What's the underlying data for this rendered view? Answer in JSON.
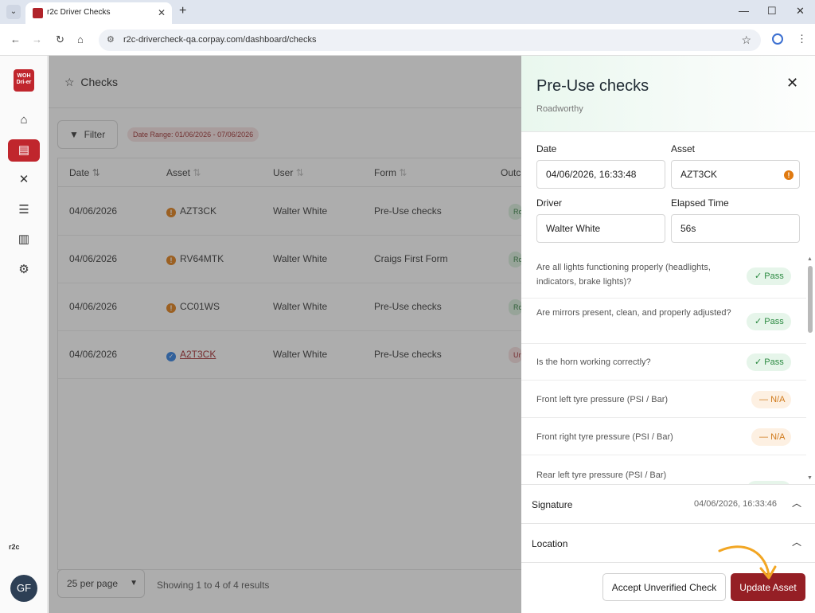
{
  "browser": {
    "tab_title": "r2c Driver Checks",
    "url": "r2c-drivercheck-qa.corpay.com/dashboard/checks"
  },
  "sidebar": {
    "logo_text": "Dri-er",
    "items": [
      {
        "icon": "home-icon"
      },
      {
        "icon": "clipboard-icon",
        "active": true
      },
      {
        "icon": "tools-icon"
      },
      {
        "icon": "list-icon"
      },
      {
        "icon": "chart-icon"
      },
      {
        "icon": "settings-icon"
      }
    ],
    "brand": "r2c",
    "avatar_initials": "GF"
  },
  "page": {
    "title": "Checks",
    "filter_label": "Filter",
    "date_range": "Date Range: 01/06/2026 - 07/06/2026"
  },
  "table": {
    "headers": [
      "Date",
      "Asset",
      "User",
      "Form",
      "Outc"
    ],
    "rows": [
      {
        "date": "04/06/2026",
        "asset": "AZT3CK",
        "verified": false,
        "user": "Walter White",
        "form": "Pre-Use checks",
        "outcome": "Roa",
        "outcome_color": "green"
      },
      {
        "date": "04/06/2026",
        "asset": "RV64MTK",
        "verified": false,
        "user": "Walter White",
        "form": "Craigs First Form",
        "outcome": "Roa",
        "outcome_color": "green"
      },
      {
        "date": "04/06/2026",
        "asset": "CC01WS",
        "verified": false,
        "user": "Walter White",
        "form": "Pre-Use checks",
        "outcome": "Roa",
        "outcome_color": "green"
      },
      {
        "date": "04/06/2026",
        "asset": "A2T3CK",
        "verified": true,
        "user": "Walter White",
        "form": "Pre-Use checks",
        "outcome": "Unv",
        "outcome_color": "red"
      }
    ],
    "per_page": "25 per page",
    "showing": "Showing 1 to 4 of 4 results"
  },
  "panel": {
    "title": "Pre-Use checks",
    "subtitle": "Roadworthy",
    "fields": {
      "date_label": "Date",
      "date_value": "04/06/2026, 16:33:48",
      "asset_label": "Asset",
      "asset_value": "AZT3CK",
      "driver_label": "Driver",
      "driver_value": "Walter White",
      "elapsed_label": "Elapsed Time",
      "elapsed_value": "56s"
    },
    "questions": [
      {
        "text": "Are all lights functioning properly (headlights, indicators, brake lights)?",
        "result": "Pass"
      },
      {
        "text": "Are mirrors present, clean, and properly adjusted?",
        "result": "Pass"
      },
      {
        "text": "Is the horn working correctly?",
        "result": "Pass"
      },
      {
        "text": "Front left tyre pressure (PSI / Bar)",
        "result": "N/A"
      },
      {
        "text": "Front right tyre pressure (PSI / Bar)",
        "result": "N/A"
      },
      {
        "text": "Rear left tyre pressure (PSI / Bar)",
        "result": "Pass"
      }
    ],
    "signature_label": "Signature",
    "signature_value": "04/06/2026, 16:33:46",
    "location_label": "Location",
    "accept_button": "Accept Unverified Check",
    "update_button": "Update Asset",
    "colors": {
      "primary": "#951f25",
      "brand": "#c0262d",
      "pass": "#2c8a42",
      "na": "#d07a1c",
      "annotation": "#f2a623"
    }
  }
}
